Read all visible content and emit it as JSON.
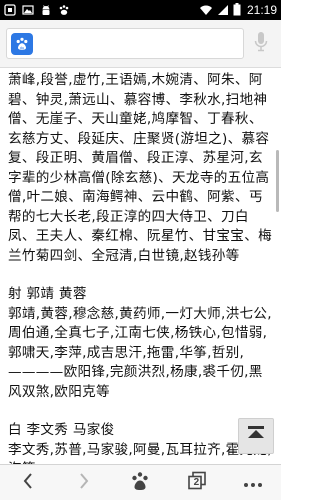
{
  "status_bar": {
    "time": "21:19",
    "left_icons": [
      "notification-icon",
      "image-icon",
      "android-icon",
      "baidu-paw-icon"
    ],
    "right_icons": [
      "wifi-icon",
      "signal-icon",
      "battery-icon"
    ]
  },
  "search": {
    "placeholder": "",
    "icon": "baidu-paw-icon",
    "mic_icon": "microphone-icon"
  },
  "content": {
    "paragraphs": [
      {
        "type": "text",
        "text": "萧峰,段誉,虚竹,王语嫣,木婉清、阿朱、阿碧、钟灵,萧远山、慕容博、李秋水,扫地神僧、无崖子、天山童姥,鸠摩智、丁春秋、玄慈方丈、段延庆、庄聚贤(游坦之)、慕容复、段正明、黄眉僧、段正淳、苏星河,玄字辈的少林高僧(除玄慈)、天龙寺的五位高僧,叶二娘、南海鳄神、云中鹤、阿紫、丐帮的七大长老,段正淳的四大侍卫、刀白凤、王夫人、秦红棉、阮星竹、甘宝宝、梅兰竹菊四剑、全冠清,白世镜,赵钱孙等"
      },
      {
        "type": "heading",
        "text": "射 郭靖 黄蓉"
      },
      {
        "type": "text",
        "text": "郭靖,黄蓉,穆念慈,黄药师,一灯大师,洪七公,周伯通,全真七子,江南七侠,杨铁心,包惜弱,郭啸天,李萍,成吉思汗,拖雷,华筝,哲别,————欧阳锋,完颜洪烈,杨康,裘千仞,黑风双煞,欧阳克等"
      },
      {
        "type": "heading",
        "text": "白 李文秀 马家俊"
      },
      {
        "type": "text",
        "text": "李文秀,苏普,马家骏,阿曼,瓦耳拉齐,霍元龙,海等"
      }
    ]
  },
  "toolbar": {
    "items": [
      "back-icon",
      "forward-icon",
      "baidu-paw-icon",
      "tabs-icon",
      "more-icon"
    ],
    "tab_count": "2"
  },
  "colors": {
    "status_bar": "#000000",
    "accent": "#2d78e4",
    "toolbar_bg": "#f7f7f7",
    "text": "#111111"
  }
}
